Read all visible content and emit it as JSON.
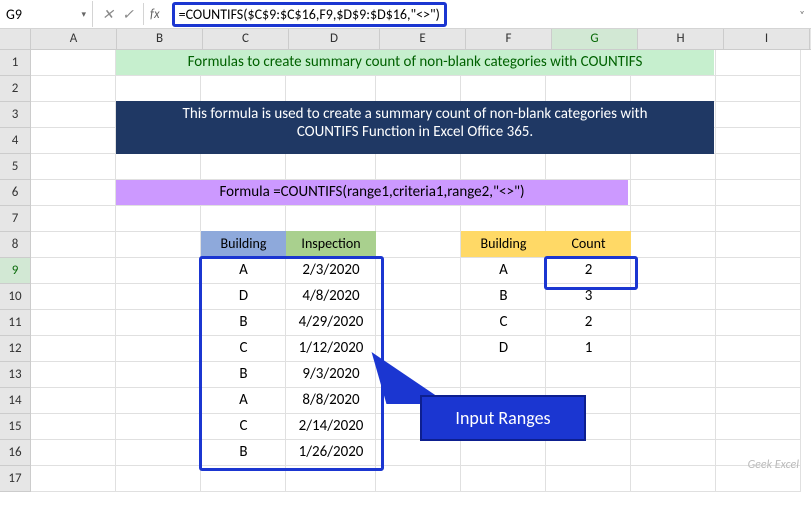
{
  "formula_bar": {
    "name_box": "G9",
    "fx_label": "fx",
    "formula": "=COUNTIFS($C$9:$C$16,F9,$D$9:$D$16,\"<>\")"
  },
  "columns": [
    "A",
    "B",
    "C",
    "D",
    "E",
    "F",
    "G",
    "H",
    "I"
  ],
  "row_numbers": [
    "1",
    "2",
    "3",
    "4",
    "5",
    "6",
    "7",
    "8",
    "9",
    "10",
    "11",
    "12",
    "13",
    "14",
    "15",
    "16",
    "17"
  ],
  "banners": {
    "green": "Formulas to create summary count of non-blank categories with COUNTIFS",
    "navy_line1": "This formula is used to create a summary count of non-blank categories with",
    "navy_line2": "COUNTIFS Function in Excel Office 365.",
    "purple": "Formula =COUNTIFS(range1,criteria1,range2,\"<>\")"
  },
  "headers": {
    "building1": "Building",
    "inspection": "Inspection",
    "building2": "Building",
    "count": "Count"
  },
  "input_table": [
    {
      "building": "A",
      "inspection": "2/3/2020"
    },
    {
      "building": "D",
      "inspection": "4/8/2020"
    },
    {
      "building": "B",
      "inspection": "4/29/2020"
    },
    {
      "building": "C",
      "inspection": "1/12/2020"
    },
    {
      "building": "B",
      "inspection": "9/3/2020"
    },
    {
      "building": "A",
      "inspection": "8/8/2020"
    },
    {
      "building": "C",
      "inspection": "2/14/2020"
    },
    {
      "building": "B",
      "inspection": "1/26/2020"
    }
  ],
  "summary_table": [
    {
      "building": "A",
      "count": "2"
    },
    {
      "building": "B",
      "count": "3"
    },
    {
      "building": "C",
      "count": "2"
    },
    {
      "building": "D",
      "count": "1"
    }
  ],
  "callout": "Input Ranges",
  "watermark": "Geek Excel",
  "icons": {
    "dropdown": "▾",
    "cancel": "✕",
    "confirm": "✓",
    "expand": "˅"
  }
}
